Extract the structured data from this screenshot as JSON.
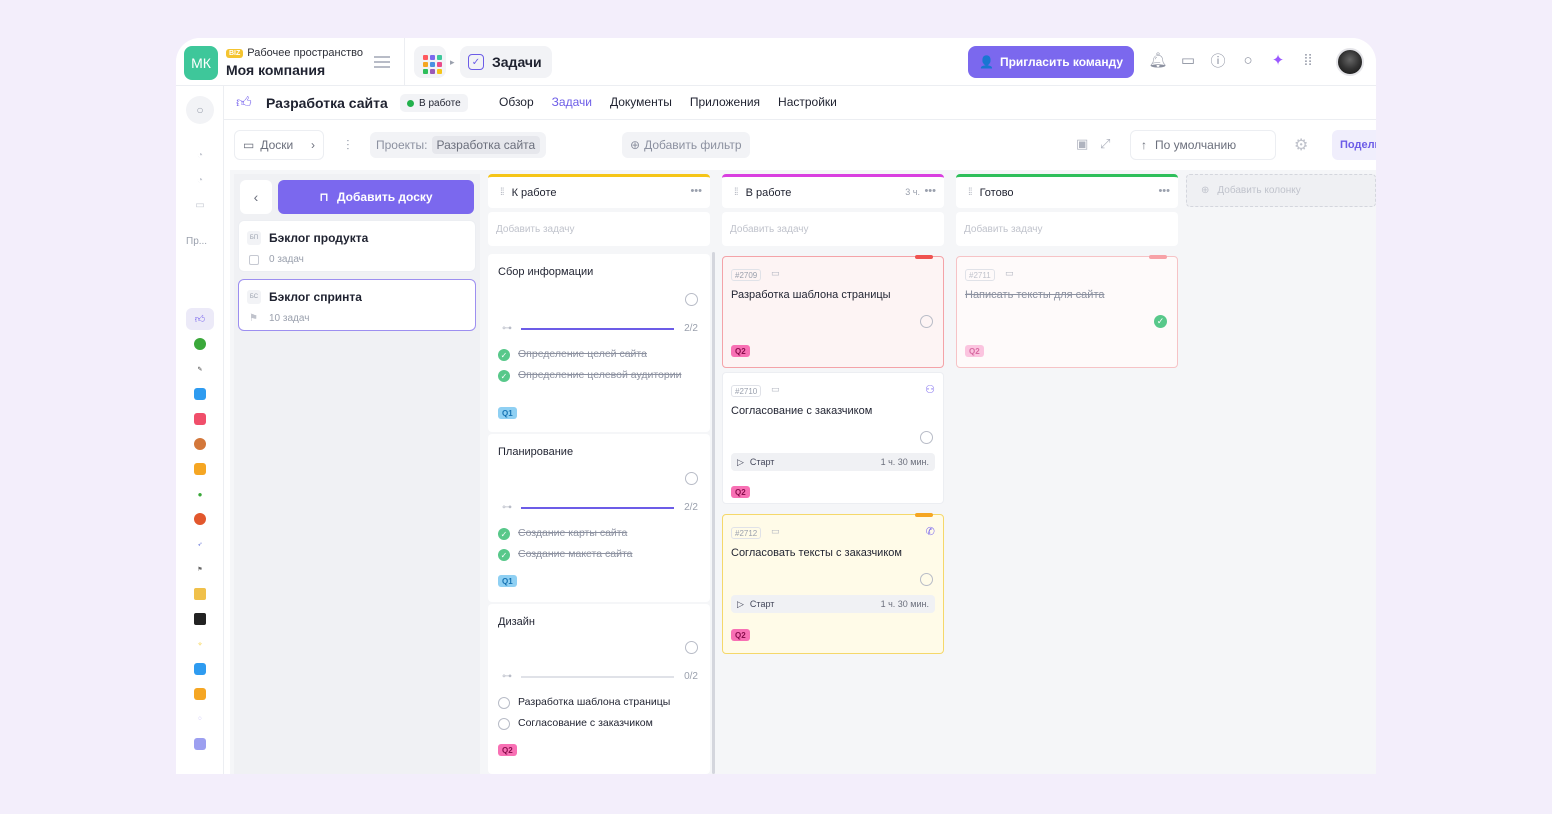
{
  "workspace": {
    "badge": "BIZ",
    "label": "Рабочее пространство",
    "name": "Моя компания",
    "avatar": "МК"
  },
  "top": {
    "section": "Задачи",
    "invite": "Пригласить команду"
  },
  "project": {
    "title": "Разработка сайта",
    "status": "В работе",
    "tabs": [
      "Обзор",
      "Задачи",
      "Документы",
      "Приложения",
      "Настройки"
    ]
  },
  "rail": {
    "projects_label": "Пр..."
  },
  "toolbar": {
    "boards": "Доски",
    "projects_label": "Проекты:",
    "project_chip": "Разработка сайта",
    "add_filter": "Добавить фильтр",
    "sort": "По умолчанию",
    "share": "Поделиться"
  },
  "boards": {
    "add": "Добавить доску",
    "items": [
      {
        "badge": "БП",
        "title": "Бэклог продукта",
        "count": "0 задач"
      },
      {
        "badge": "БС",
        "title": "Бэклог спринта",
        "count": "10 задач"
      }
    ]
  },
  "columns": [
    {
      "title": "К работе",
      "color": "#f5c518",
      "add": "Добавить задачу"
    },
    {
      "title": "В работе",
      "color": "#d93fe0",
      "count": "3 ч.",
      "add": "Добавить задачу"
    },
    {
      "title": "Готово",
      "color": "#2fbf5b",
      "add": "Добавить задачу"
    }
  ],
  "add_column": "Добавить колонку",
  "groups": [
    {
      "title": "Сбор информации",
      "progress": "2/2",
      "fill": 1.0,
      "subtasks": [
        "Определение целей сайта",
        "Определение целевой аудитории"
      ],
      "tag": "Q1"
    },
    {
      "title": "Планирование",
      "progress": "2/2",
      "fill": 1.0,
      "subtasks": [
        "Создание карты сайта",
        "Создание макета сайта"
      ],
      "tag": "Q1"
    },
    {
      "title": "Дизайн",
      "progress": "0/2",
      "fill": 0.0,
      "subtasks": [
        "Разработка шаблона страницы",
        "Согласование с заказчиком"
      ],
      "tag": "Q2"
    }
  ],
  "tasks": [
    {
      "num": "#2709",
      "title": "Разработка шаблона страницы",
      "tag": "Q2"
    },
    {
      "num": "#2710",
      "title": "Согласование с заказчиком",
      "timer_label": "Старт",
      "timer": "1 ч. 30 мин.",
      "tag": "Q2"
    },
    {
      "num": "#2712",
      "title": "Согласовать тексты с заказчиком",
      "timer_label": "Старт",
      "timer": "1 ч. 30 мин.",
      "tag": "Q2"
    },
    {
      "num": "#2711",
      "title": "Написать тексты для сайта",
      "tag": "Q2"
    }
  ],
  "colors": {
    "accent": "#7b68ee",
    "done": "#58c88a"
  }
}
